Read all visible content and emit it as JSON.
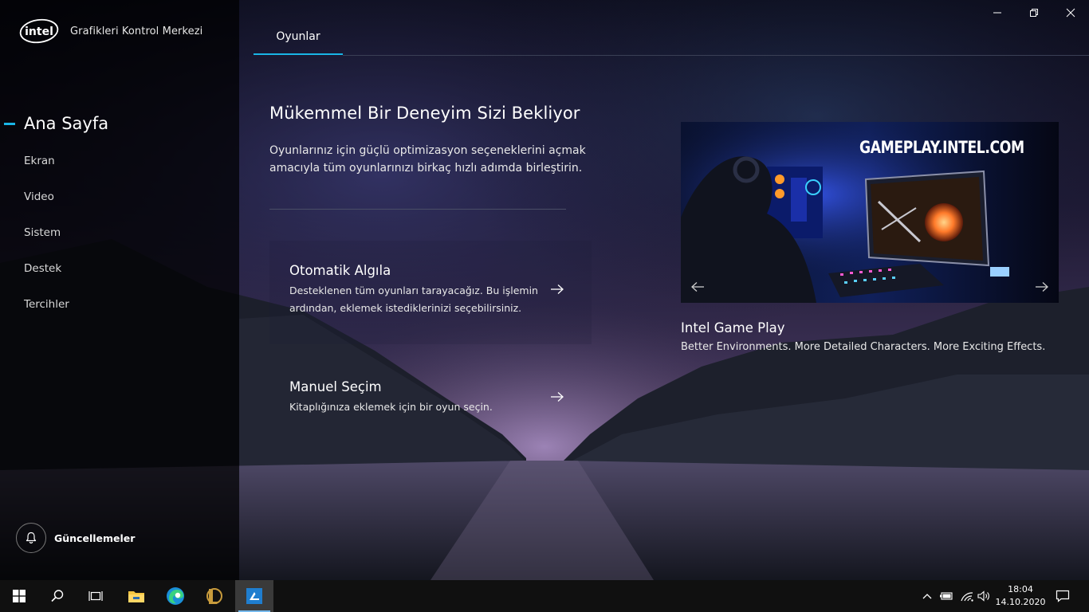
{
  "app": {
    "brand_logo_text": "intel",
    "title": "Grafikleri Kontrol Merkezi"
  },
  "sidebar": {
    "items": [
      {
        "label": "Ana Sayfa"
      },
      {
        "label": "Ekran"
      },
      {
        "label": "Video"
      },
      {
        "label": "Sistem"
      },
      {
        "label": "Destek"
      },
      {
        "label": "Tercihler"
      }
    ],
    "updates_label": "Güncellemeler"
  },
  "tabs": [
    {
      "label": "Oyunlar"
    }
  ],
  "hero": {
    "title": "Mükemmel Bir Deneyim Sizi Bekliyor",
    "description": "Oyunlarınız için güçlü optimizasyon seçeneklerini açmak amacıyla tüm oyunlarınızı birkaç hızlı adımda birleştirin."
  },
  "cards": [
    {
      "title": "Otomatik Algıla",
      "description": "Desteklenen tüm oyunları tarayacağız. Bu işlemin ardından, eklemek istediklerinizi seçebilirsiniz."
    },
    {
      "title": "Manuel Seçim",
      "description": "Kitaplığınıza eklemek için bir oyun seçin."
    }
  ],
  "promo": {
    "headline": "GAMEPLAY.INTEL.COM",
    "title": "Intel Game Play",
    "subtitle": "Better Environments. More Detailed Characters. More Exciting Effects."
  },
  "taskbar": {
    "time": "18:04",
    "date": "14.10.2020"
  },
  "colors": {
    "accent": "#19b5e6",
    "sidebar_bg": "#000000",
    "taskbar_bg": "#101010"
  },
  "icons": {
    "window_controls": [
      "minimize-icon",
      "restore-icon",
      "close-icon"
    ],
    "taskbar": [
      "windows-start-icon",
      "search-icon",
      "task-view-icon",
      "file-explorer-icon",
      "edge-icon",
      "league-of-legends-icon",
      "intel-graphics-icon"
    ],
    "tray": [
      "chevron-up-icon",
      "battery-icon",
      "wifi-icon",
      "volume-icon",
      "notification-icon"
    ]
  }
}
